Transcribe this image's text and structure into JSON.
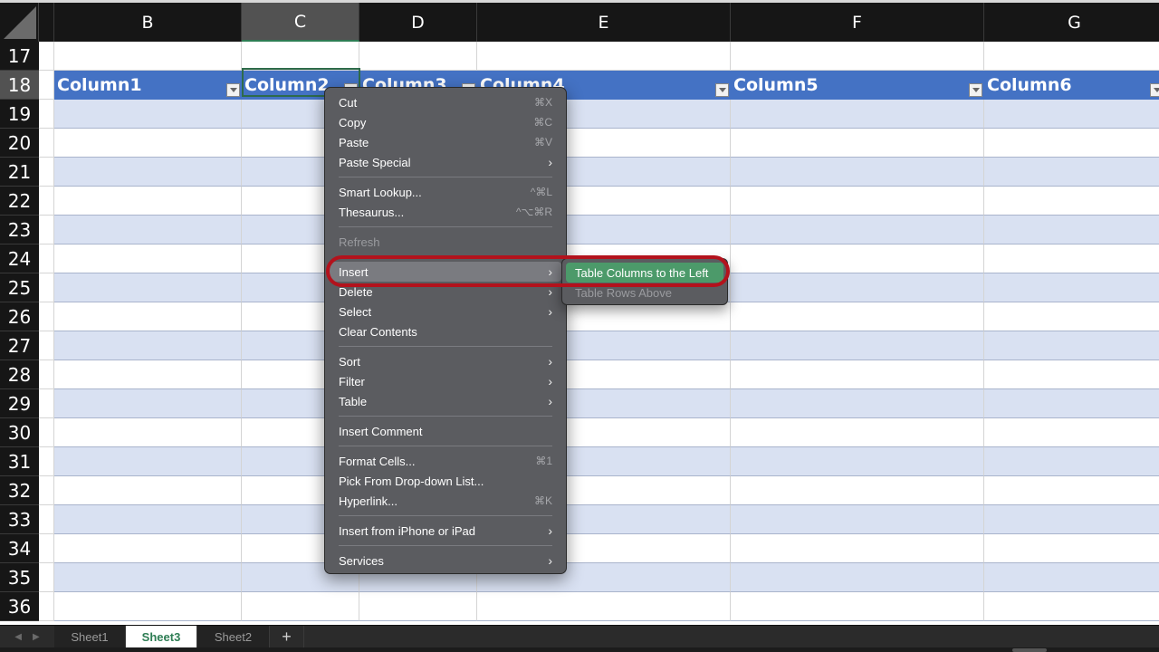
{
  "columns": [
    {
      "letter": "",
      "key": "A"
    },
    {
      "letter": "B"
    },
    {
      "letter": "C",
      "selected": true
    },
    {
      "letter": "D"
    },
    {
      "letter": "E"
    },
    {
      "letter": "F"
    },
    {
      "letter": "G"
    }
  ],
  "rows": [
    "17",
    "18",
    "19",
    "20",
    "21",
    "22",
    "23",
    "24",
    "25",
    "26",
    "27",
    "28",
    "29",
    "30",
    "31",
    "32",
    "33",
    "34",
    "35",
    "36"
  ],
  "selected_row": "18",
  "table": {
    "headers": [
      "Column1",
      "Column2",
      "Column3",
      "Column4",
      "Column5",
      "Column6"
    ],
    "header_color": "#4472c4",
    "band_color": "#d9e1f2"
  },
  "context_menu": {
    "groups": [
      [
        {
          "label": "Cut",
          "shortcut": "⌘X"
        },
        {
          "label": "Copy",
          "shortcut": "⌘C"
        },
        {
          "label": "Paste",
          "shortcut": "⌘V"
        },
        {
          "label": "Paste Special",
          "submenu": true
        }
      ],
      [
        {
          "label": "Smart Lookup...",
          "shortcut": "^⌘L"
        },
        {
          "label": "Thesaurus...",
          "shortcut": "^⌥⌘R"
        }
      ],
      [
        {
          "label": "Refresh",
          "disabled": true
        }
      ],
      [
        {
          "label": "Insert",
          "submenu": true,
          "hover": true
        },
        {
          "label": "Delete",
          "submenu": true
        },
        {
          "label": "Select",
          "submenu": true
        },
        {
          "label": "Clear Contents"
        }
      ],
      [
        {
          "label": "Sort",
          "submenu": true
        },
        {
          "label": "Filter",
          "submenu": true
        },
        {
          "label": "Table",
          "submenu": true
        }
      ],
      [
        {
          "label": "Insert Comment"
        }
      ],
      [
        {
          "label": "Format Cells...",
          "shortcut": "⌘1"
        },
        {
          "label": "Pick From Drop-down List..."
        },
        {
          "label": "Hyperlink...",
          "shortcut": "⌘K"
        }
      ],
      [
        {
          "label": "Insert from iPhone or iPad",
          "submenu": true
        }
      ],
      [
        {
          "label": "Services",
          "submenu": true
        }
      ]
    ]
  },
  "insert_submenu": [
    {
      "label": "Table Columns to the Left",
      "active": true
    },
    {
      "label": "Table Rows Above",
      "disabled": true
    }
  ],
  "highlight_color": "#b3121c",
  "sheet_tabs": [
    {
      "label": "Sheet1"
    },
    {
      "label": "Sheet3",
      "active": true
    },
    {
      "label": "Sheet2"
    }
  ],
  "add_sheet_label": "+",
  "nav_prev_icon": "◀",
  "nav_next_icon": "▶"
}
